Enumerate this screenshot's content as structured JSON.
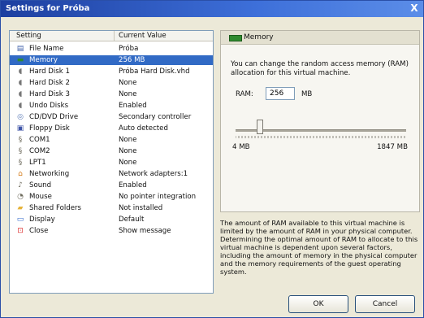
{
  "window": {
    "title": "Settings for Próba",
    "close_label": "X"
  },
  "list": {
    "headers": {
      "setting": "Setting",
      "value": "Current Value"
    },
    "rows": [
      {
        "label": "File Name",
        "value": "Próba",
        "icon": "file-icon"
      },
      {
        "label": "Memory",
        "value": "256 MB",
        "icon": "memory-icon",
        "selected": true
      },
      {
        "label": "Hard Disk 1",
        "value": "Próba Hard Disk.vhd",
        "icon": "hard-disk-icon"
      },
      {
        "label": "Hard Disk 2",
        "value": "None",
        "icon": "hard-disk-icon"
      },
      {
        "label": "Hard Disk 3",
        "value": "None",
        "icon": "hard-disk-icon"
      },
      {
        "label": "Undo Disks",
        "value": "Enabled",
        "icon": "undo-disk-icon"
      },
      {
        "label": "CD/DVD Drive",
        "value": "Secondary controller",
        "icon": "cd-icon"
      },
      {
        "label": "Floppy Disk",
        "value": "Auto detected",
        "icon": "floppy-icon"
      },
      {
        "label": "COM1",
        "value": "None",
        "icon": "port-icon"
      },
      {
        "label": "COM2",
        "value": "None",
        "icon": "port-icon"
      },
      {
        "label": "LPT1",
        "value": "None",
        "icon": "port-icon"
      },
      {
        "label": "Networking",
        "value": "Network adapters:1",
        "icon": "network-icon"
      },
      {
        "label": "Sound",
        "value": "Enabled",
        "icon": "sound-icon"
      },
      {
        "label": "Mouse",
        "value": "No pointer integration",
        "icon": "mouse-icon"
      },
      {
        "label": "Shared Folders",
        "value": "Not installed",
        "icon": "folder-icon"
      },
      {
        "label": "Display",
        "value": "Default",
        "icon": "display-icon"
      },
      {
        "label": "Close",
        "value": "Show message",
        "icon": "close-icon"
      }
    ]
  },
  "memory_panel": {
    "title": "Memory",
    "description": "You can change the random access memory (RAM) allocation for this virtual machine.",
    "ram_label": "RAM:",
    "ram_value": "256",
    "ram_unit": "MB",
    "slider": {
      "min_label": "4 MB",
      "max_label": "1847 MB",
      "value_mb": 256,
      "min_mb": 4,
      "max_mb": 1847
    }
  },
  "info_text": "The amount of RAM available to this virtual machine is limited by the amount of RAM in your physical computer. Determining the optimal amount of RAM to allocate to this virtual machine is dependent upon several factors, including the amount of memory in the physical computer and the memory requirements of the guest operating system.",
  "buttons": {
    "ok": "OK",
    "cancel": "Cancel"
  },
  "colors": {
    "title_bar": "#1d3fa0",
    "selection": "#316ac5"
  }
}
